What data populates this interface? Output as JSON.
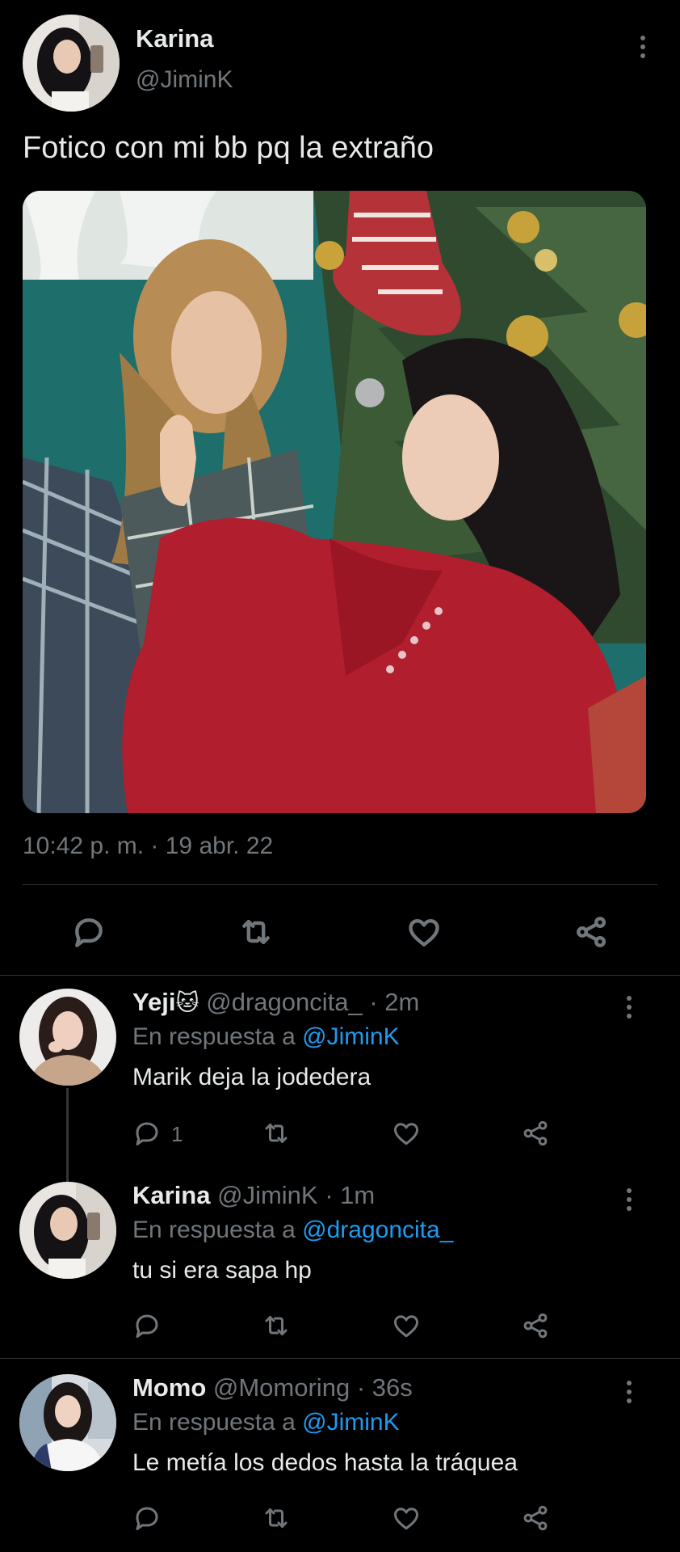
{
  "main_tweet": {
    "author_name": "Karina",
    "author_handle": "@JiminK",
    "text": "Fotico con mi bb pq la extraño",
    "timestamp": "10:42 p. m. · 19 abr. 22"
  },
  "replies": [
    {
      "name": "Yeji",
      "emoji": "🐱",
      "handle": "@dragoncita_",
      "time": "· 2m",
      "reply_prefix": "En respuesta a",
      "reply_to": "@JiminK",
      "text": "Marik deja la jodedera",
      "reply_count": "1"
    },
    {
      "name": "Karina",
      "handle": "@JiminK",
      "time": "· 1m",
      "reply_prefix": "En respuesta a",
      "reply_to": "@dragoncita_",
      "text": "tu si era sapa hp",
      "reply_count": ""
    },
    {
      "name": "Momo",
      "handle": "@Momoring",
      "time": "· 36s",
      "reply_prefix": "En respuesta a",
      "reply_to": "@JiminK",
      "text": "Le metía los dedos hasta la tráquea",
      "reply_count": ""
    }
  ],
  "colors": {
    "background": "#000000",
    "text": "#e7e9ea",
    "muted": "#71767b",
    "link": "#1d9bf0",
    "divider": "#2f3336"
  },
  "icons": [
    "more-icon",
    "reply-icon",
    "retweet-icon",
    "like-icon",
    "share-icon"
  ]
}
